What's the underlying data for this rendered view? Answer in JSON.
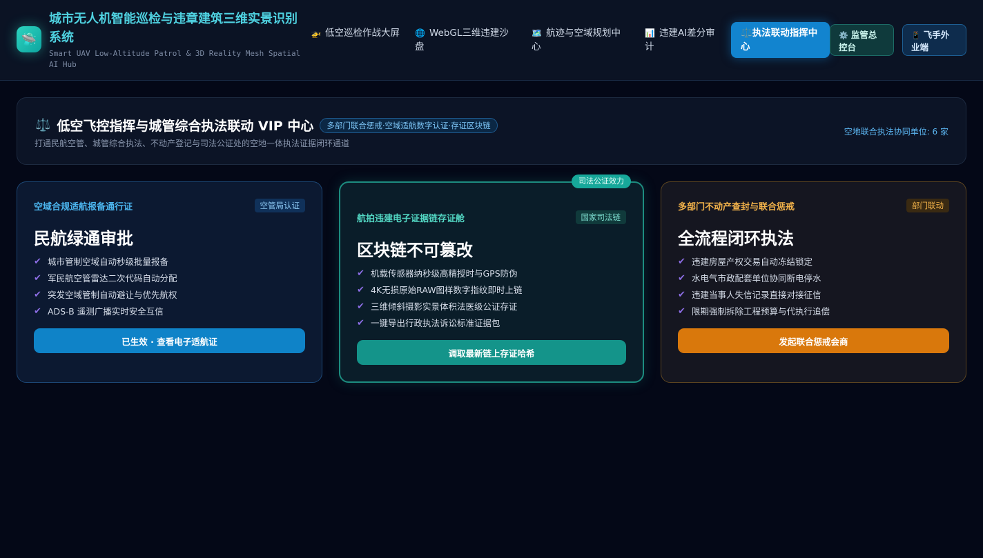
{
  "header": {
    "logo_glyph": "🛸",
    "title": "城市无人机智能巡检与违章建筑三维实景识别系统",
    "subtitle": "Smart UAV Low-Altitude Patrol & 3D Reality Mesh Spatial AI Hub",
    "nav": [
      {
        "icon": "🚁",
        "label": "低空巡检作战大屏"
      },
      {
        "icon": "🌐",
        "label": "WebGL三维违建沙盘"
      },
      {
        "icon": "🗺️",
        "label": "航迹与空域规划中心"
      },
      {
        "icon": "📊",
        "label": "违建AI差分审计"
      },
      {
        "icon": "⚖️",
        "label": "执法联动指挥中心"
      }
    ],
    "buttons": [
      {
        "icon": "⚙️",
        "label": "监管总控台"
      },
      {
        "icon": "📱",
        "label": "飞手外业端"
      }
    ]
  },
  "hero": {
    "icon": "⚖️",
    "title": "低空飞控指挥与城管综合执法联动 VIP 中心",
    "badge": "多部门联合惩戒·空域适航数字认证·存证区块链",
    "desc": "打通民航空管、城管综合执法、不动产登记与司法公证处的空地一体执法证据闭环通道",
    "right_text": "空地联合执法协同单位: 6 家"
  },
  "cards": [
    {
      "kicker": "空域合规适航报备通行证",
      "tag": "空管局认证",
      "title": "民航绿通审批",
      "items": [
        "城市管制空域自动秒级批量报备",
        "军民航空管雷达二次代码自动分配",
        "突发空域管制自动避让与优先航权",
        "ADS-B 遥测广播实时安全互信"
      ],
      "button": "已生效 · 查看电子适航证"
    },
    {
      "ribbon": "司法公证效力",
      "kicker": "航拍违建电子证据链存证舱",
      "tag": "国家司法链",
      "title": "区块链不可篡改",
      "items": [
        "机载传感器纳秒级高精授时与GPS防伪",
        "4K无损原始RAW图样数字指纹即时上链",
        "三维倾斜摄影实景体积法医级公证存证",
        "一键导出行政执法诉讼标准证据包"
      ],
      "button": "调取最新链上存证哈希"
    },
    {
      "kicker": "多部门不动产查封与联合惩戒",
      "tag": "部门联动",
      "title": "全流程闭环执法",
      "items": [
        "违建房屋产权交易自动冻结锁定",
        "水电气市政配套单位协同断电停水",
        "违建当事人失信记录直接对接征信",
        "限期强制拆除工程预算与代执行追偿"
      ],
      "button": "发起联合惩戒会商"
    }
  ],
  "check_glyph": "✔"
}
